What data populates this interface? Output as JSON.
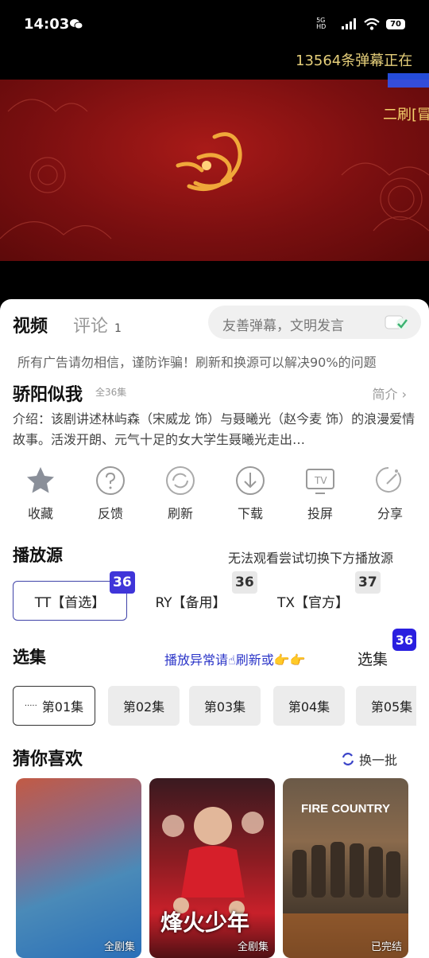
{
  "status_bar": {
    "time": "14:03",
    "network": "5G HD",
    "battery": "70"
  },
  "video": {
    "danmu_count_text": "13564条弹幕正在",
    "danmu_line_2": "二刷[冒"
  },
  "tabs": {
    "video": "视频",
    "comment": "评论",
    "comment_count": "1"
  },
  "danmu_input": {
    "placeholder": "友善弹幕，文明发言"
  },
  "notice": "所有广告请勿相信，谨防诈骗！刷新和换源可以解决90%的问题",
  "show": {
    "title": "骄阳似我",
    "episodes_total": "全36集",
    "intro_link": "简介 ›",
    "description": "介绍：该剧讲述林屿森（宋威龙 饰）与聂曦光（赵今麦 饰）的浪漫爱情故事。活泼开朗、元气十足的女大学生聂曦光走出…"
  },
  "actions": [
    {
      "label": "收藏",
      "icon": "star-icon"
    },
    {
      "label": "反馈",
      "icon": "feedback-icon"
    },
    {
      "label": "刷新",
      "icon": "refresh-icon"
    },
    {
      "label": "下载",
      "icon": "download-icon"
    },
    {
      "label": "投屏",
      "icon": "cast-tv-icon"
    },
    {
      "label": "分享",
      "icon": "share-icon"
    }
  ],
  "sources": {
    "title": "播放源",
    "hint": "无法观看尝试切换下方播放源",
    "items": [
      {
        "label": "TT【首选】",
        "count": "36",
        "active": true
      },
      {
        "label": "RY【备用】",
        "count": "36",
        "active": false
      },
      {
        "label": "TX【官方】",
        "count": "37",
        "active": false
      }
    ]
  },
  "episodes": {
    "title": "选集",
    "hint": "播放异常请☝刷新或👉👉",
    "label": "选集",
    "count": "36",
    "items": [
      "第01集",
      "第02集",
      "第03集",
      "第04集",
      "第05集"
    ],
    "playing_indicator": "·····"
  },
  "recommend": {
    "title": "猜你喜欢",
    "refresh": "换一批",
    "cards": [
      {
        "tag": "全剧集"
      },
      {
        "title": "烽火少年",
        "tag": "全剧集"
      },
      {
        "title": "FIRE COUNTRY",
        "tag": "已完结"
      }
    ]
  },
  "colors": {
    "accent": "#3f35d9",
    "hint_blue": "#2b35c8",
    "banner_red": "#7a0f10",
    "danmu_gold": "#e6cf7a"
  }
}
